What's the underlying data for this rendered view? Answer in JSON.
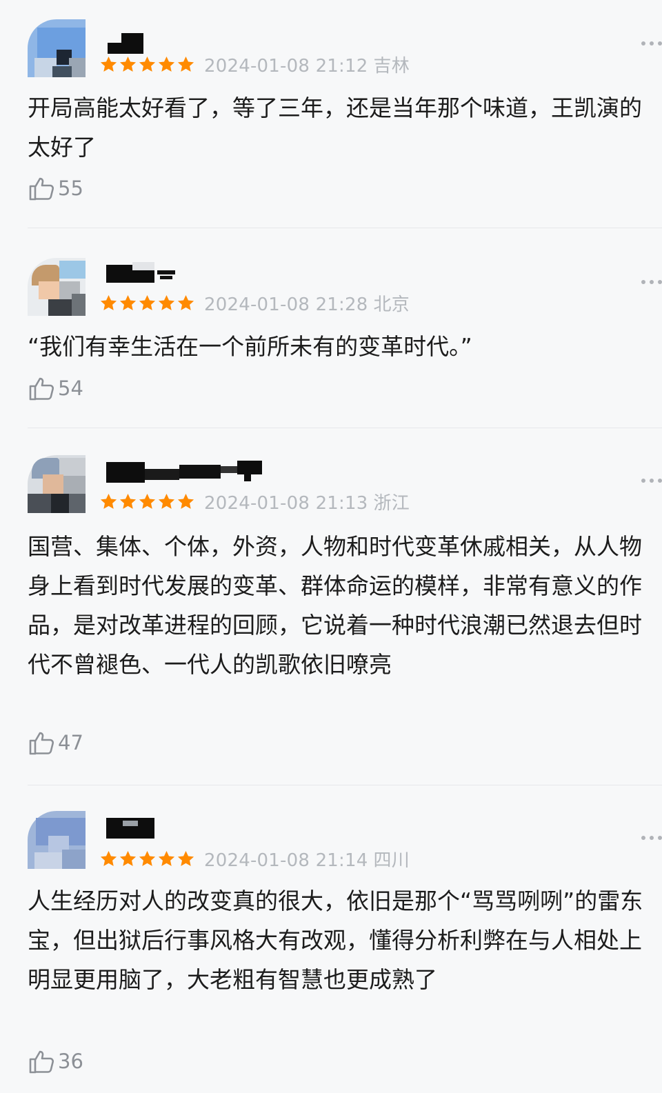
{
  "reviews": [
    {
      "rating": 5,
      "timestamp": "2024-01-08 21:12",
      "location": "吉林",
      "content": "开局高能太好看了，等了三年，还是当年那个味道，王凯演的太好了",
      "likes": "55"
    },
    {
      "rating": 5,
      "timestamp": "2024-01-08 21:28",
      "location": "北京",
      "content": "“我们有幸生活在一个前所未有的变革时代。”",
      "likes": "54"
    },
    {
      "rating": 5,
      "timestamp": "2024-01-08 21:13",
      "location": "浙江",
      "content": "国营、集体、个体，外资，人物和时代变革休戚相关，从人物身上看到时代发展的变革、群体命运的模样，非常有意义的作品，是对改革进程的回顾，它说着一种时代浪潮已然退去但时代不曾褪色、一代人的凯歌依旧嘹亮",
      "likes": "47"
    },
    {
      "rating": 5,
      "timestamp": "2024-01-08 21:14",
      "location": "四川",
      "content": "人生经历对人的改变真的很大，依旧是那个“骂骂咧咧”的雷东宝，但出狱后行事风格大有改观，懂得分析利弊在与人相处上明显更用脑了，大老粗有智慧也更成熟了",
      "likes": "36"
    }
  ],
  "icons": {
    "star": "star-icon",
    "like": "thumbs-up-icon",
    "more": "more-dots-icon"
  },
  "colors": {
    "star": "#ff8a00",
    "meta_text": "#b4b8bd",
    "like": "#8c9096",
    "body_text": "#1c1c1c",
    "background": "#f7f8f9"
  }
}
